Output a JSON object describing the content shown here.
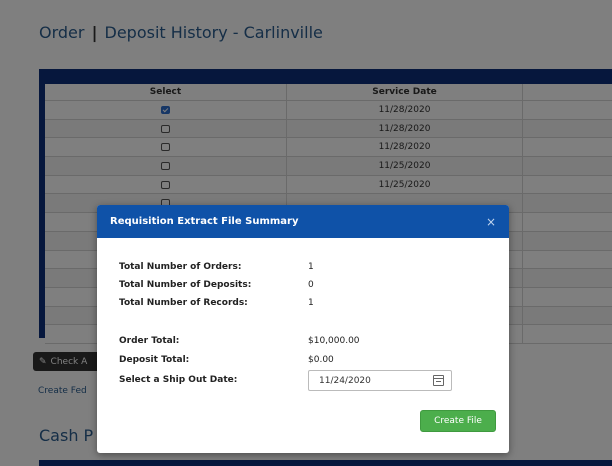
{
  "page": {
    "title_order": "Order",
    "title_separator": "|",
    "title_rest": "Deposit History - Carlinville",
    "cash_title": "Cash P",
    "check_button": "Check A",
    "create_link": "Create Fed"
  },
  "table": {
    "headers": {
      "select": "Select",
      "service_date": "Service Date"
    },
    "rows": [
      {
        "checked": true,
        "date": "11/28/2020"
      },
      {
        "checked": false,
        "date": "11/28/2020"
      },
      {
        "checked": false,
        "date": "11/28/2020"
      },
      {
        "checked": false,
        "date": "11/25/2020"
      },
      {
        "checked": false,
        "date": "11/25/2020"
      },
      {
        "checked": false,
        "date": ""
      },
      {
        "checked": false,
        "date": ""
      },
      {
        "checked": false,
        "date": ""
      },
      {
        "checked": false,
        "date": ""
      },
      {
        "checked": false,
        "date": ""
      },
      {
        "checked": false,
        "date": ""
      },
      {
        "checked": false,
        "date": ""
      },
      {
        "checked": false,
        "date": ""
      }
    ]
  },
  "modal": {
    "title": "Requisition Extract File Summary",
    "close": "×",
    "orders_label": "Total Number of Orders:",
    "orders_value": "1",
    "deposits_label": "Total Number of Deposits:",
    "deposits_value": "0",
    "records_label": "Total Number of Records:",
    "records_value": "1",
    "order_total_label": "Order Total:",
    "order_total_value": "$10,000.00",
    "deposit_total_label": "Deposit Total:",
    "deposit_total_value": "$0.00",
    "ship_date_label": "Select a Ship Out Date:",
    "ship_date_value": "11/24/2020",
    "create_button": "Create File"
  },
  "colors": {
    "accent": "#0f52a8",
    "table_frame": "#0d2f7a",
    "create_button": "#4cae4c"
  }
}
